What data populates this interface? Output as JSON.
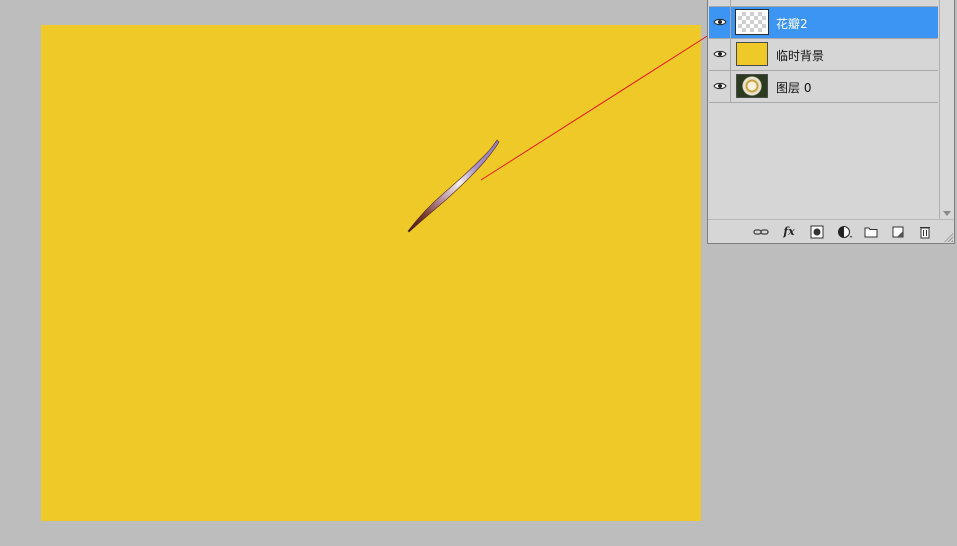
{
  "colors": {
    "workspace_bg": "#bdbdbd",
    "canvas_fill": "#eec928",
    "selection_highlight": "#3c95f3",
    "annotation_arrow": "#e8141a"
  },
  "layers_panel": {
    "layers": [
      {
        "name": "",
        "visible": true,
        "selected": false,
        "thumbnail": "partial",
        "partially_visible": true
      },
      {
        "name": "花瓣2",
        "visible": true,
        "selected": true,
        "thumbnail": "transparent-checkerboard"
      },
      {
        "name": "临时背景",
        "visible": true,
        "selected": false,
        "thumbnail": "yellow-fill"
      },
      {
        "name": "图层 0",
        "visible": true,
        "selected": false,
        "thumbnail": "flower-image"
      }
    ],
    "toolbar_icons": [
      "link-layers-icon",
      "layer-style-fx-icon",
      "layer-mask-icon",
      "adjustment-layer-icon",
      "new-group-icon",
      "new-layer-icon",
      "delete-layer-icon"
    ],
    "toolbar_labels": {
      "fx": "fx"
    }
  }
}
